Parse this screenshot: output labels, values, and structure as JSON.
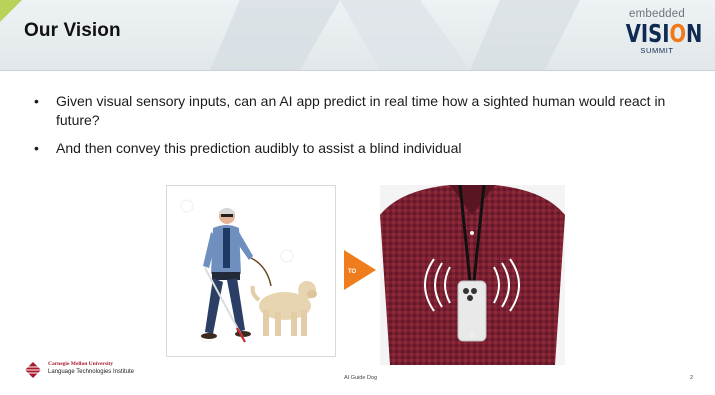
{
  "slide": {
    "title": "Our Vision",
    "bullets": [
      "Given visual sensory inputs, can an AI app predict in real time how a sighted human would react in future?",
      "And then convey this prediction audibly to assist a blind individual"
    ],
    "arrow_label": "TO"
  },
  "logo": {
    "top": "embedded",
    "main_a": "VISI",
    "main_accent": "O",
    "main_b": "N",
    "sub": "SUMMIT"
  },
  "footer": {
    "university": "Carnegie Mellon University",
    "institute": "Language Technologies Institute",
    "center_text": "AI Guide Dog",
    "page_number": "2"
  },
  "colors": {
    "arrow": "#ef7d1d",
    "brand_navy": "#0f2a52",
    "brand_orange": "#f07a1a",
    "cmu_red": "#a6192e"
  },
  "icons": [
    "bullet-dot",
    "cmu-logo-icon",
    "orange-arrow-icon"
  ]
}
